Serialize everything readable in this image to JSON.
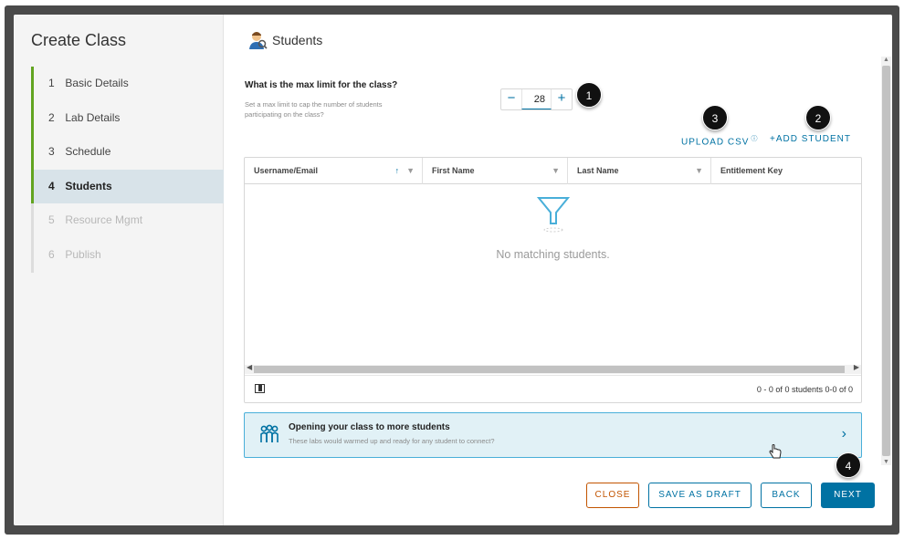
{
  "sidebar": {
    "title": "Create Class",
    "steps": [
      {
        "num": "1",
        "label": "Basic Details"
      },
      {
        "num": "2",
        "label": "Lab Details"
      },
      {
        "num": "3",
        "label": "Schedule"
      },
      {
        "num": "4",
        "label": "Students"
      },
      {
        "num": "5",
        "label": "Resource Mgmt"
      },
      {
        "num": "6",
        "label": "Publish"
      }
    ]
  },
  "main": {
    "title": "Students",
    "max_limit": {
      "question": "What is the max limit for the class?",
      "help": "Set a max limit to cap the number of students participating on the class?",
      "value": "28",
      "minus": "−",
      "plus": "+"
    },
    "actions": {
      "upload_csv": "UPLOAD CSV",
      "add_student": "+ADD STUDENT"
    },
    "grid": {
      "columns": [
        "Username/Email",
        "First Name",
        "Last Name",
        "Entitlement Key"
      ],
      "empty_text": "No matching students.",
      "pager": "0 - 0 of 0 students 0-0 of 0"
    },
    "banner": {
      "title": "Opening your class to more students",
      "subtitle": "These labs would warmed up and ready for any student to connect?"
    }
  },
  "footer": {
    "close": "CLOSE",
    "save_draft": "SAVE AS DRAFT",
    "back": "BACK",
    "next": "NEXT"
  },
  "callouts": [
    "1",
    "2",
    "3",
    "4"
  ],
  "colors": {
    "accent": "#0072a3",
    "danger": "#c25400",
    "progress_green": "#62a420",
    "active_step_bg": "#d8e3e9"
  }
}
